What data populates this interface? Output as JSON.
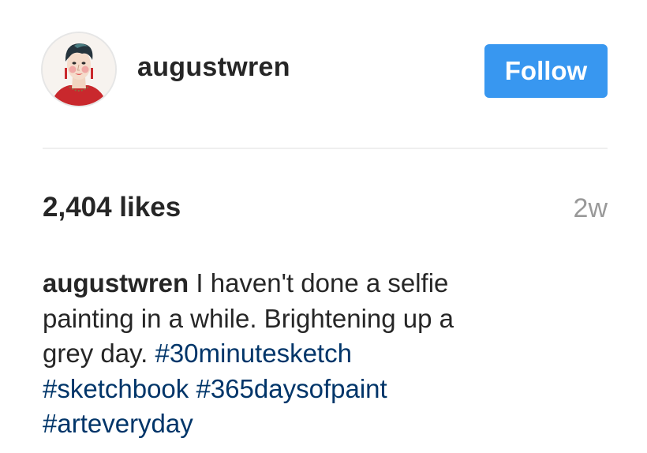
{
  "post": {
    "username": "augustwren",
    "follow_label": "Follow",
    "likes": "2,404 likes",
    "timestamp": "2w",
    "caption": {
      "username": "augustwren",
      "text_line1": "I haven't done a selfie",
      "text_line2": "painting in a while. Brightening up a",
      "text_line3": "grey day.",
      "hashtags": [
        "#30minutesketch",
        "#sketchbook",
        "#365daysofpaint",
        "#arteveryday"
      ]
    }
  },
  "colors": {
    "follow_button": "#3897f0",
    "hashtag": "#003569",
    "timestamp": "#999999",
    "text": "#262626"
  },
  "icons": {
    "avatar": "painted-selfie-portrait"
  }
}
